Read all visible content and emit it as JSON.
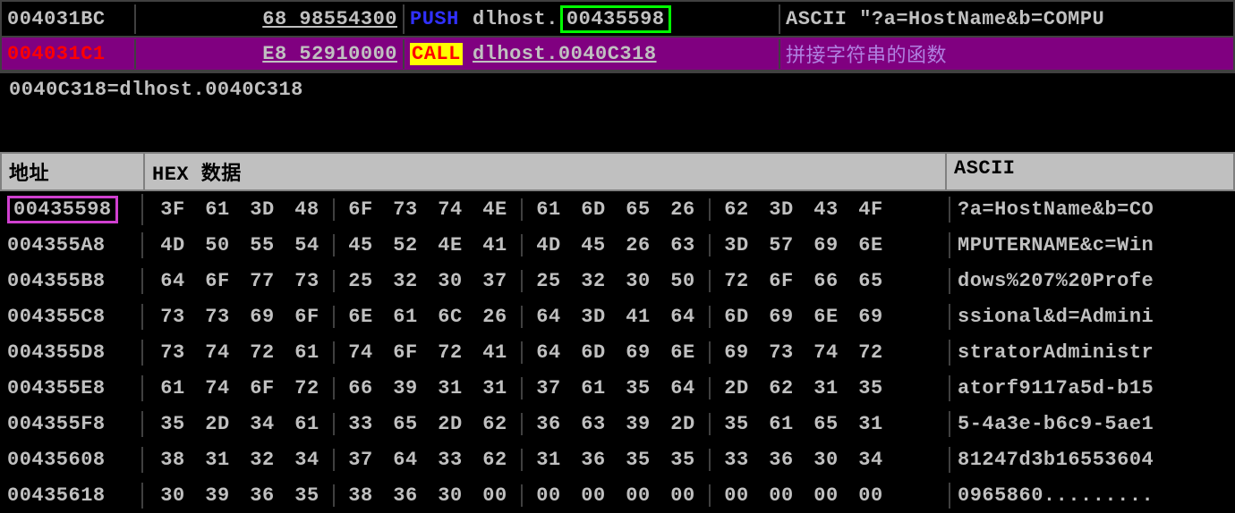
{
  "disasm": {
    "rows": [
      {
        "addr": "004031BC",
        "bytes": "68 98554300",
        "mnemonic": "PUSH",
        "opPrefix": "dlhost.",
        "opHighlight": "00435598",
        "comment": "ASCII \"?a=HostName&b=COMPU"
      },
      {
        "addr": "004031C1",
        "bytes": "E8 52910000",
        "mnemonic": "CALL",
        "operand": "dlhost.0040C318",
        "comment": "拼接字符串的函数"
      }
    ]
  },
  "info": "0040C318=dlhost.0040C318",
  "hexHeader": {
    "addr": "地址",
    "hex": "HEX 数据",
    "ascii": "ASCII"
  },
  "hexRows": [
    {
      "addr": "00435598",
      "highlight": true,
      "hex": [
        "3F",
        "61",
        "3D",
        "48",
        "6F",
        "73",
        "74",
        "4E",
        "61",
        "6D",
        "65",
        "26",
        "62",
        "3D",
        "43",
        "4F"
      ],
      "ascii": "?a=HostName&b=CO"
    },
    {
      "addr": "004355A8",
      "hex": [
        "4D",
        "50",
        "55",
        "54",
        "45",
        "52",
        "4E",
        "41",
        "4D",
        "45",
        "26",
        "63",
        "3D",
        "57",
        "69",
        "6E"
      ],
      "ascii": "MPUTERNAME&c=Win"
    },
    {
      "addr": "004355B8",
      "hex": [
        "64",
        "6F",
        "77",
        "73",
        "25",
        "32",
        "30",
        "37",
        "25",
        "32",
        "30",
        "50",
        "72",
        "6F",
        "66",
        "65"
      ],
      "ascii": "dows%207%20Profe"
    },
    {
      "addr": "004355C8",
      "hex": [
        "73",
        "73",
        "69",
        "6F",
        "6E",
        "61",
        "6C",
        "26",
        "64",
        "3D",
        "41",
        "64",
        "6D",
        "69",
        "6E",
        "69"
      ],
      "ascii": "ssional&d=Admini"
    },
    {
      "addr": "004355D8",
      "hex": [
        "73",
        "74",
        "72",
        "61",
        "74",
        "6F",
        "72",
        "41",
        "64",
        "6D",
        "69",
        "6E",
        "69",
        "73",
        "74",
        "72"
      ],
      "ascii": "stratorAdministr"
    },
    {
      "addr": "004355E8",
      "hex": [
        "61",
        "74",
        "6F",
        "72",
        "66",
        "39",
        "31",
        "31",
        "37",
        "61",
        "35",
        "64",
        "2D",
        "62",
        "31",
        "35"
      ],
      "ascii": "atorf9117a5d-b15"
    },
    {
      "addr": "004355F8",
      "hex": [
        "35",
        "2D",
        "34",
        "61",
        "33",
        "65",
        "2D",
        "62",
        "36",
        "63",
        "39",
        "2D",
        "35",
        "61",
        "65",
        "31"
      ],
      "ascii": "5-4a3e-b6c9-5ae1"
    },
    {
      "addr": "00435608",
      "hex": [
        "38",
        "31",
        "32",
        "34",
        "37",
        "64",
        "33",
        "62",
        "31",
        "36",
        "35",
        "35",
        "33",
        "36",
        "30",
        "34"
      ],
      "ascii": "81247d3b16553604"
    },
    {
      "addr": "00435618",
      "hex": [
        "30",
        "39",
        "36",
        "35",
        "38",
        "36",
        "30",
        "00",
        "00",
        "00",
        "00",
        "00",
        "00",
        "00",
        "00",
        "00"
      ],
      "ascii": "0965860........."
    }
  ]
}
